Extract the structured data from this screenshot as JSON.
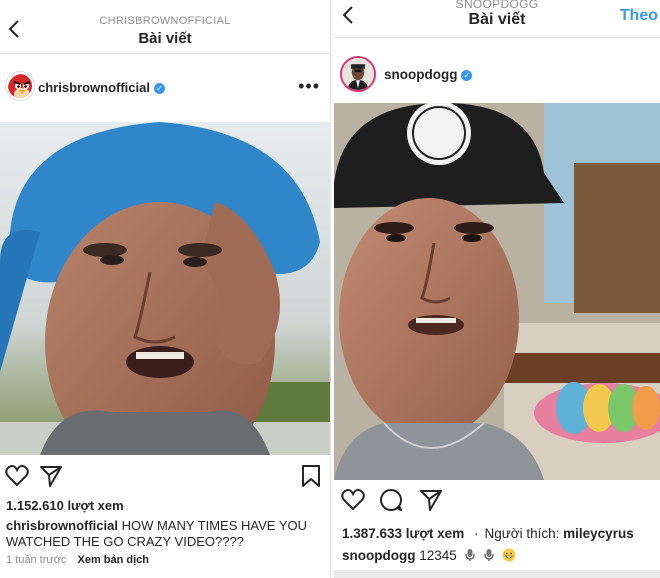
{
  "left": {
    "header": {
      "subtitle": "CHRISBROWNOFFICIAL",
      "title": "Bài viết"
    },
    "user": {
      "name": "chrisbrownofficial",
      "verified": true,
      "avatar_icon": "red-angry-bird-avatar"
    },
    "views": "1.152.610 lượt xem",
    "caption": {
      "user": "chrisbrownofficial",
      "text": "HOW MANY TIMES HAVE YOU WATCHED THE GO CRAZY VIDEO????"
    },
    "time": "1 tuần trước",
    "translate": "Xem bản dịch",
    "icons": [
      "chevron-left-icon",
      "more-icon",
      "heart-icon",
      "send-icon",
      "bookmark-icon"
    ]
  },
  "right": {
    "header": {
      "subtitle": "SNOOPDOGG",
      "title": "Bài viết",
      "follow": "Theo"
    },
    "user": {
      "name": "snoopdogg",
      "verified": true
    },
    "views": "1.387.633 lượt xem",
    "liked_by_label": "Người thích:",
    "liked_by_user": "mileycyrus",
    "caption": {
      "user": "snoopdogg",
      "text": "12345"
    },
    "icons": [
      "chevron-left-icon",
      "heart-icon",
      "comment-icon",
      "send-icon",
      "microphone-emoji",
      "grin-emoji"
    ]
  },
  "colors": {
    "accent": "#3897f0",
    "text": "#262626",
    "muted": "#8e8e8e"
  }
}
